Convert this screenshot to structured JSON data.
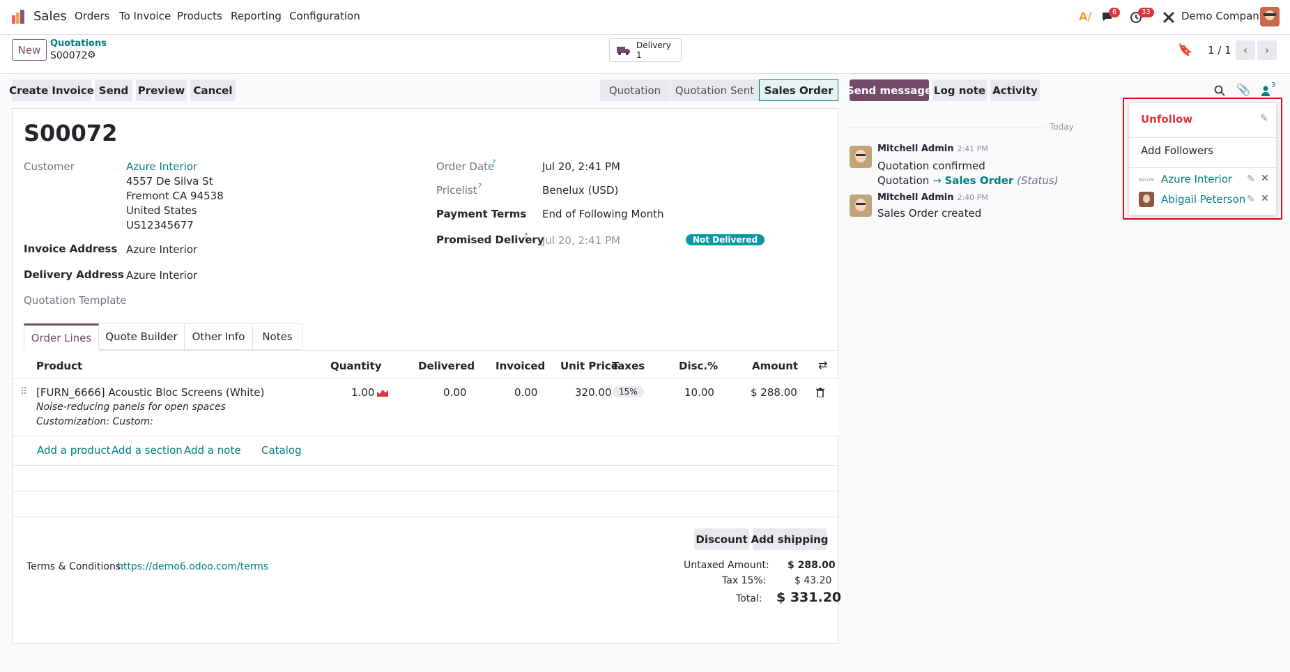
{
  "navbar": {
    "app_name": "Sales",
    "menu": [
      "Orders",
      "To Invoice",
      "Products",
      "Reporting",
      "Configuration"
    ],
    "messages_count": "6",
    "activities_count": "33",
    "company": "Demo Company"
  },
  "control": {
    "new_label": "New",
    "breadcrumb_parent": "Quotations",
    "record_name": "S00072",
    "delivery_label": "Delivery",
    "delivery_count": "1",
    "pager": "1 / 1"
  },
  "statusbar": {
    "buttons": [
      "Create Invoice",
      "Send",
      "Preview",
      "Cancel"
    ],
    "stages": [
      "Quotation",
      "Quotation Sent",
      "Sales Order"
    ],
    "active_stage": "Sales Order"
  },
  "form": {
    "title": "S00072",
    "customer_label": "Customer",
    "customer_name": "Azure Interior",
    "address": [
      "4557 De Silva St",
      "Fremont CA 94538",
      "United States",
      "US12345677"
    ],
    "invoice_address_label": "Invoice Address",
    "invoice_address": "Azure Interior",
    "delivery_address_label": "Delivery Address",
    "delivery_address": "Azure Interior",
    "quotation_template_label": "Quotation Template",
    "order_date_label": "Order Date",
    "order_date": "Jul 20, 2:41 PM",
    "pricelist_label": "Pricelist",
    "pricelist": "Benelux (USD)",
    "payment_terms_label": "Payment Terms",
    "payment_terms": "End of Following Month",
    "promised_delivery_label": "Promised Delivery",
    "promised_delivery": "Jul 20, 2:41 PM",
    "delivery_status": "Not Delivered",
    "help_mark": "?"
  },
  "tabs": [
    "Order Lines",
    "Quote Builder",
    "Other Info",
    "Notes"
  ],
  "order_lines": {
    "headers": [
      "Product",
      "Quantity",
      "Delivered",
      "Invoiced",
      "Unit Price",
      "Taxes",
      "Disc.%",
      "Amount"
    ],
    "row": {
      "product": "[FURN_6666] Acoustic Bloc Screens (White)",
      "description1": "Noise-reducing panels for open spaces",
      "description2": "Customization: Custom:",
      "quantity": "1.00",
      "delivered": "0.00",
      "invoiced": "0.00",
      "unit_price": "320.00",
      "taxes": "15%",
      "discount": "10.00",
      "amount": "$ 288.00"
    },
    "add_product": "Add a product",
    "add_section": "Add a section",
    "add_note": "Add a note",
    "catalog": "Catalog"
  },
  "footer": {
    "discount_btn": "Discount",
    "shipping_btn": "Add shipping",
    "terms_label": "Terms & Conditions:",
    "terms_link": "https://demo6.odoo.com/terms",
    "untaxed_label": "Untaxed Amount:",
    "untaxed_value": "$ 288.00",
    "tax_label": "Tax 15%:",
    "tax_value": "$ 43.20",
    "total_label": "Total:",
    "total_value": "$ 331.20"
  },
  "chatter": {
    "send_message": "Send message",
    "log_note": "Log note",
    "activity": "Activity",
    "followers_count": "3",
    "today": "Today",
    "messages": [
      {
        "author": "Mitchell Admin",
        "time": "2:41 PM",
        "line1": "Quotation confirmed",
        "line2_from": "Quotation",
        "arrow": "→",
        "line2_to": "Sales Order",
        "line2_field": "(Status)"
      },
      {
        "author": "Mitchell Admin",
        "time": "2:40 PM",
        "line1": "Sales Order created"
      }
    ]
  },
  "followers_dropdown": {
    "unfollow": "Unfollow",
    "add_followers": "Add Followers",
    "followers": [
      "Azure Interior",
      "Abigail Peterson"
    ]
  },
  "colors": {
    "brand": "#714b67",
    "link": "#017e84",
    "danger": "#d9363e",
    "highlight_box": "#d0101a"
  }
}
